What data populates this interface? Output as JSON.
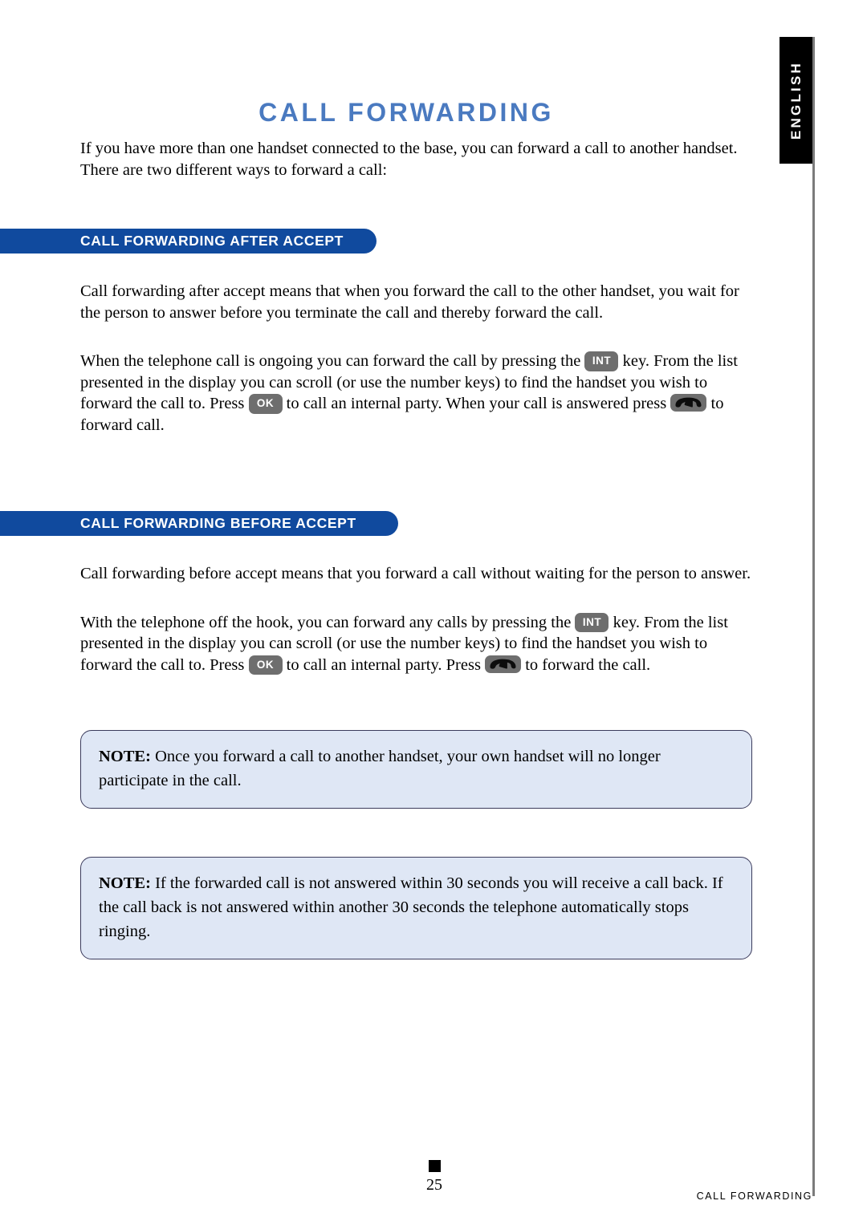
{
  "document": {
    "title": "CALL FORWARDING",
    "language_tab": "ENGLISH",
    "page_number": "25",
    "footer_label": "CALL FORWARDING"
  },
  "colors": {
    "title_blue": "#4a7ac0",
    "section_bar_blue": "#104a9e",
    "note_box_fill": "#dfe7f5",
    "note_box_border": "#3b3b5c",
    "key_gray": "#6e6e6e",
    "tab_black": "#000000",
    "rule_gray": "#7b7b7b"
  },
  "intro": {
    "text": "If you have more than one handset connected to the base, you can forward a call to another handset. There are two different ways to forward a call:"
  },
  "sections": [
    {
      "heading": "CALL FORWARDING AFTER ACCEPT",
      "paragraph_1": "Call forwarding after accept means that when you forward the call to the other handset, you wait for the person to answer before you terminate the call and thereby forward the call.",
      "paragraph_2_part_1": "When the telephone call is ongoing you can forward the call by pressing the",
      "key_int": "INT",
      "paragraph_2_part_2": "key. From the list presented in the display you can scroll (or use the number keys) to find the handset you wish to forward the call to. Press",
      "key_ok": "OK",
      "paragraph_2_part_3": "to call an internal party. When your call is answered press",
      "key_hook": "handset-hook-key",
      "paragraph_2_part_4": "to forward call."
    },
    {
      "heading": "CALL FORWARDING BEFORE ACCEPT",
      "paragraph_1": "Call forwarding before accept means that you forward a call without waiting for the person to answer.",
      "paragraph_2_part_1": "With the telephone off the hook, you can forward any calls by pressing the",
      "key_int": "INT",
      "paragraph_2_part_2": "key. From the list presented in the display you can scroll (or use the number keys) to find the handset you wish to forward the call to. Press",
      "key_ok": "OK",
      "paragraph_2_part_3": "to call an internal party. Press",
      "key_hook": "handset-hook-key",
      "paragraph_2_part_4": "to forward the call."
    }
  ],
  "notes": [
    {
      "label": "NOTE:",
      "text": " Once you forward a call to another handset, your own handset will no longer participate in the call."
    },
    {
      "label": "NOTE:",
      "text": " If the forwarded call is not answered within 30 seconds you will receive a call back. If the call back is not answered within another 30 seconds the telephone automatically stops ringing."
    }
  ]
}
